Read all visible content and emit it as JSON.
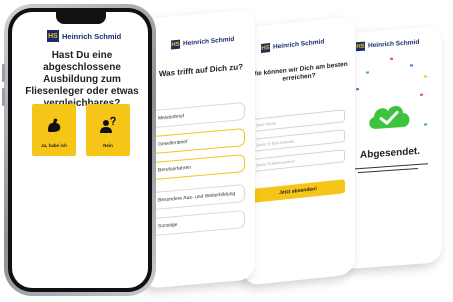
{
  "brand": {
    "logo_mark": "HS",
    "name": "Heinrich Schmid"
  },
  "screen_main": {
    "question": "Hast Du eine abgeschlossene Ausbildung zum Fliesenleger oder etwas vergleichbares?",
    "options": [
      {
        "label": "Ja, habe ich",
        "icon": "flexed-arm-icon"
      },
      {
        "label": "Nein",
        "icon": "person-question-icon"
      }
    ]
  },
  "screen_2": {
    "question": "Was trifft auf Dich zu?",
    "options": [
      {
        "label": "Meisterbrief",
        "selected": false
      },
      {
        "label": "Gesellenbrief",
        "selected": true
      },
      {
        "label": "Berufserfahren",
        "selected": true
      },
      {
        "label": "Besondere Aus- und Weiterbildung",
        "selected": false
      },
      {
        "label": "Sonstige",
        "selected": false
      }
    ]
  },
  "screen_3": {
    "question": "Wie können wir Dich am besten erreichen?",
    "fields": [
      {
        "placeholder": "Dein Name"
      },
      {
        "placeholder": "Deine E-Mail Adresse"
      },
      {
        "placeholder": "Deine Telefonnummer"
      }
    ],
    "submit_label": "Jetzt absenden!"
  },
  "screen_4": {
    "title": "Abgesendet.",
    "icon": "cloud-check-icon"
  },
  "colors": {
    "accent": "#f5c518",
    "brand": "#1b2b6b",
    "success": "#3cc43c"
  }
}
